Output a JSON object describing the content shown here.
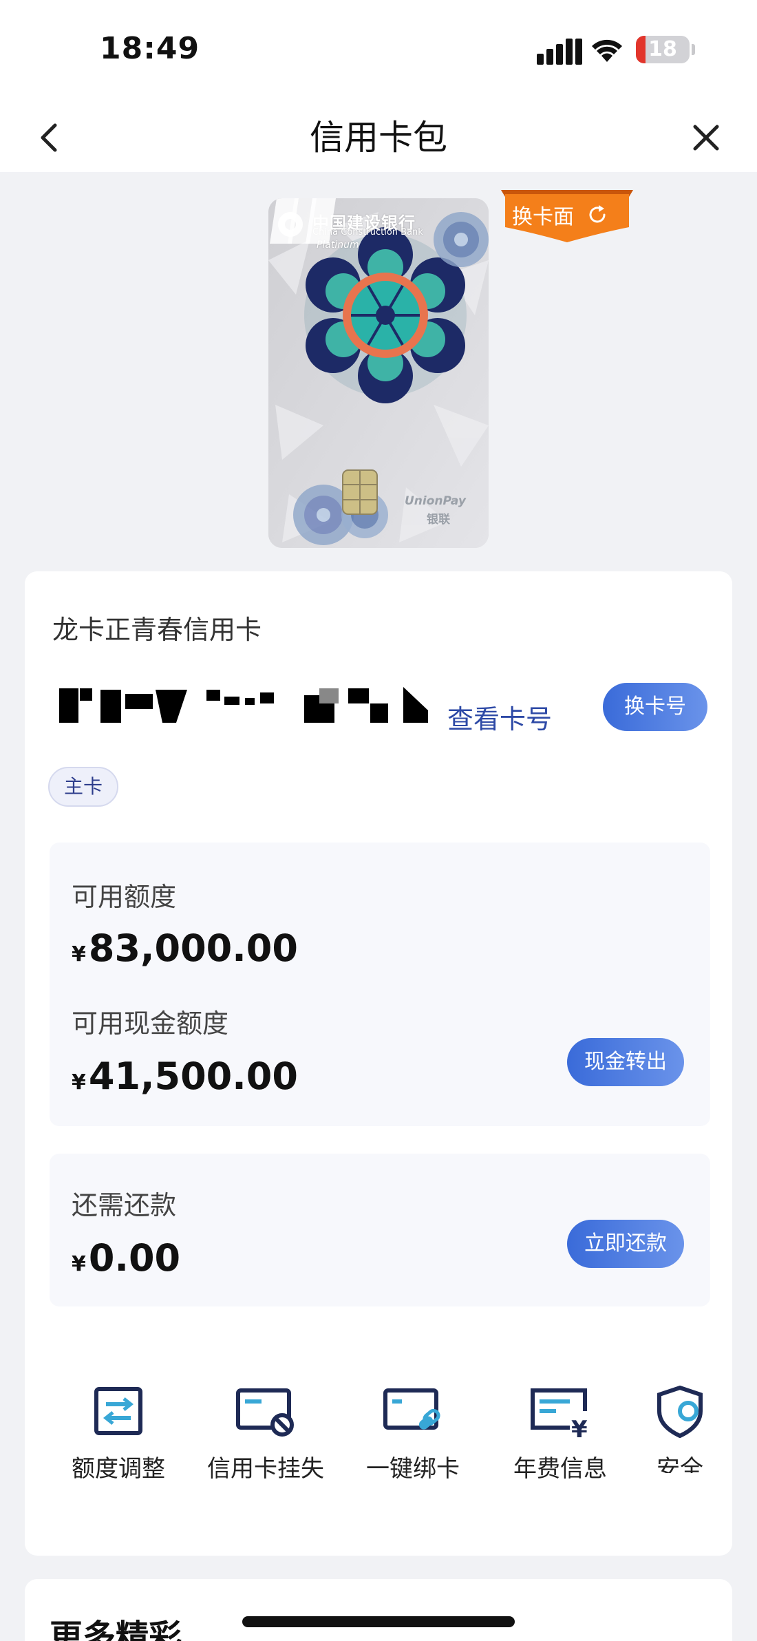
{
  "status_bar": {
    "time": "18:49",
    "battery_level": "18",
    "battery_fraction": 0.18,
    "icons": [
      "signal-icon",
      "wifi-icon",
      "battery-icon"
    ]
  },
  "nav": {
    "title": "信用卡包",
    "back_icon": "chevron-left-icon",
    "close_icon": "close-icon"
  },
  "card_image": {
    "bank_name": "中国建设银行",
    "bank_name_en": "China Construction Bank",
    "tier": "Platinum",
    "network_en": "UnionPay",
    "network_cn": "银联",
    "change_face_label": "换卡面"
  },
  "card_info": {
    "name": "龙卡正青春信用卡",
    "view_number_label": "查看卡号",
    "change_number_label": "换卡号",
    "tag": "主卡"
  },
  "credit": {
    "available_label": "可用额度",
    "available_currency": "¥",
    "available_amount": "83,000.00",
    "cash_label": "可用现金额度",
    "cash_currency": "¥",
    "cash_amount": "41,500.00",
    "cash_button": "现金转出"
  },
  "repay": {
    "label": "还需还款",
    "currency": "¥",
    "amount": "0.00",
    "button": "立即还款"
  },
  "shortcuts": [
    {
      "label": "额度调整",
      "icon": "limit-adjust-icon"
    },
    {
      "label": "信用卡挂失",
      "icon": "card-lost-icon"
    },
    {
      "label": "一键绑卡",
      "icon": "card-bind-icon"
    },
    {
      "label": "年费信息",
      "icon": "annual-fee-icon"
    },
    {
      "label": "安全",
      "icon": "security-shield-icon"
    }
  ],
  "more_section": {
    "title": "更多精彩"
  },
  "colors": {
    "accent_blue": "#3a6bd9",
    "link_blue": "#2d49a6",
    "orange": "#f47f1a",
    "icon_navy": "#1e2a55",
    "icon_cyan": "#38a7d6"
  }
}
